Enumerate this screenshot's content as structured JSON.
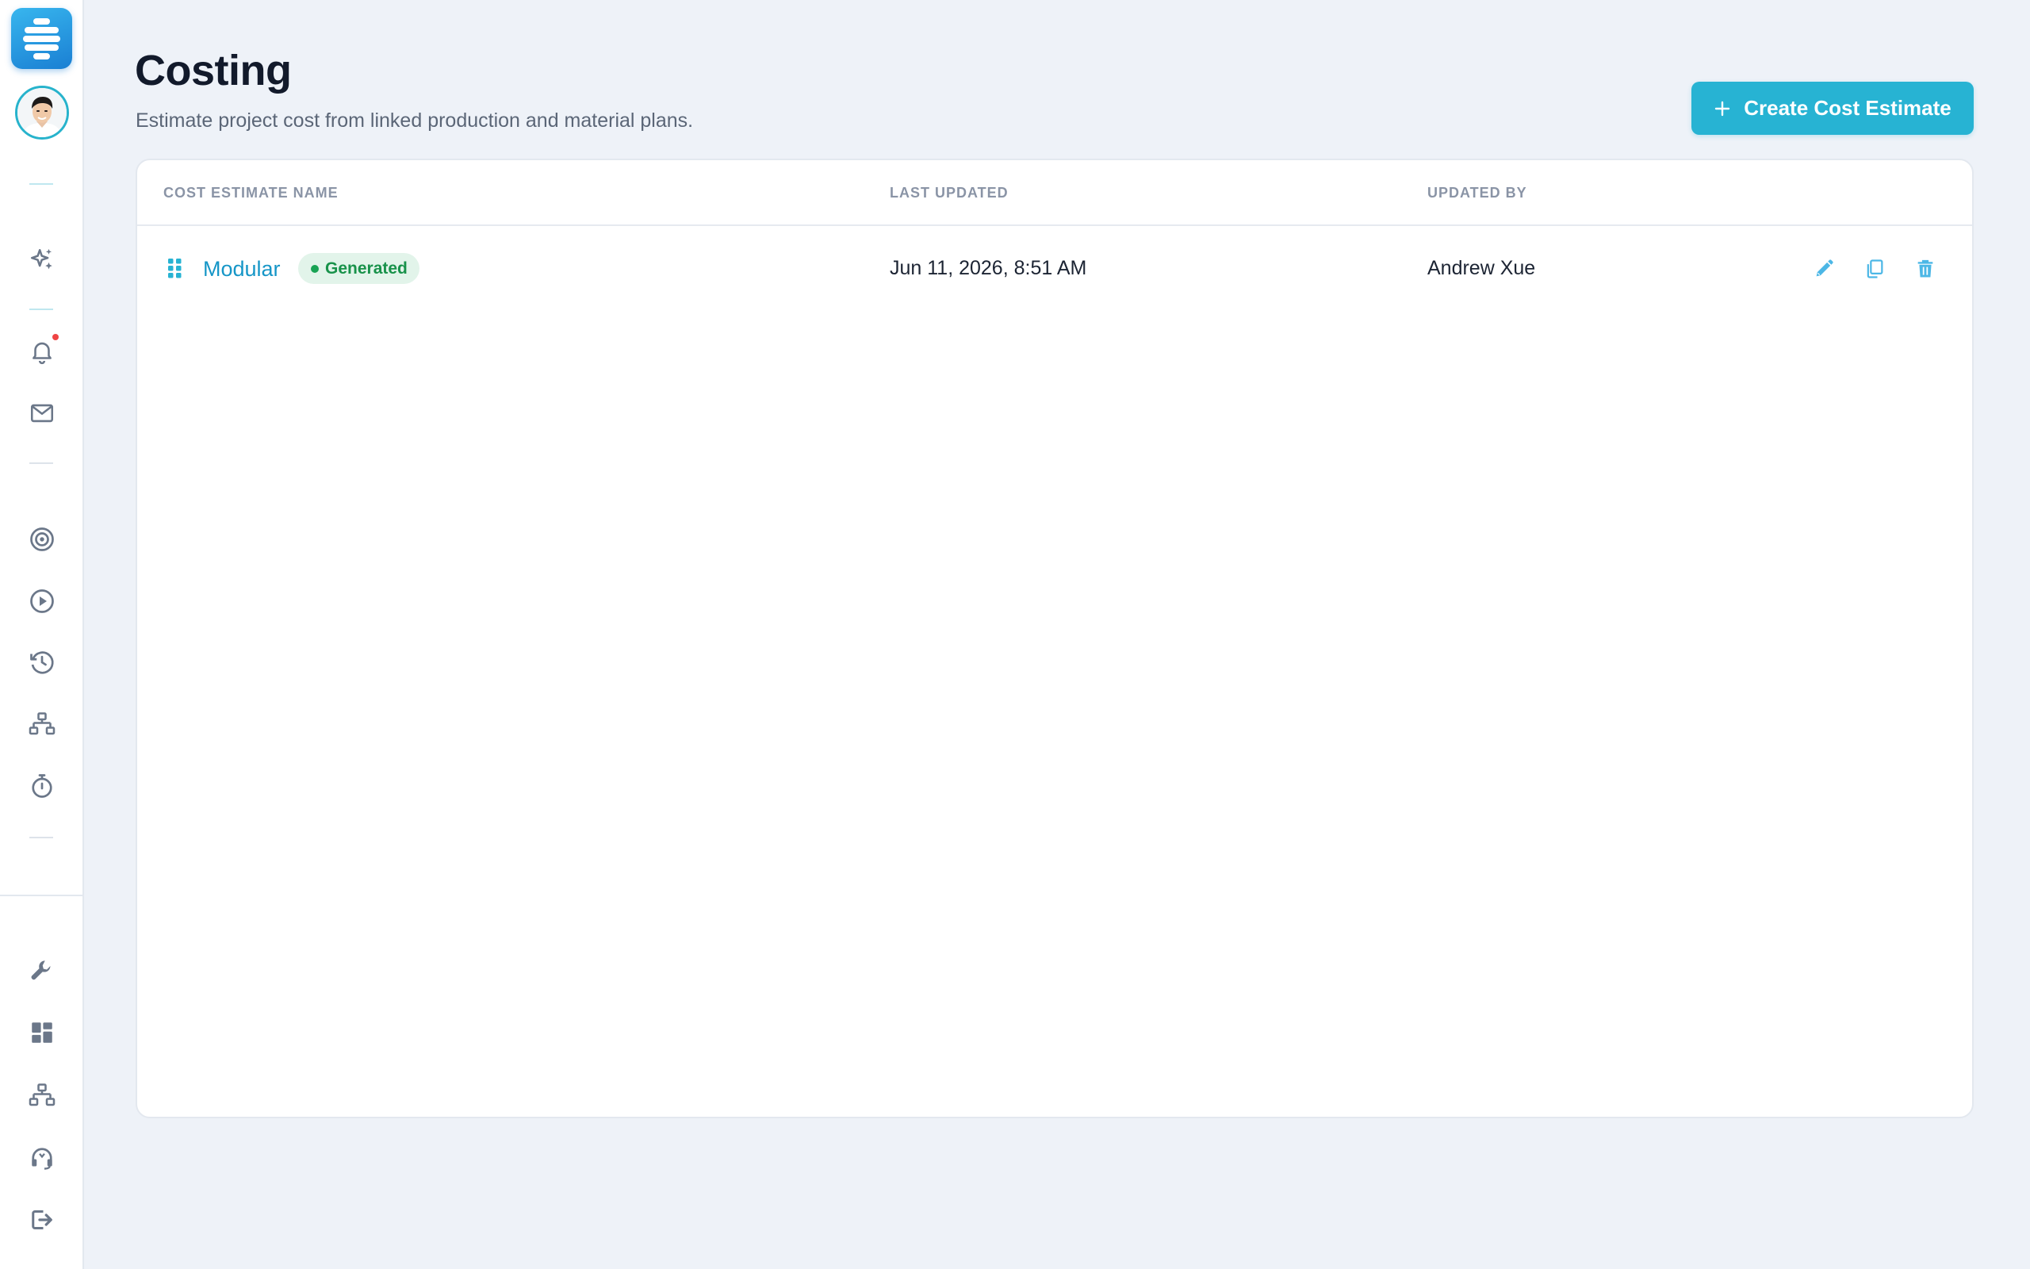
{
  "page": {
    "title": "Costing",
    "subtitle": "Estimate project cost from linked production and material plans."
  },
  "actions": {
    "create_label": "Create Cost Estimate"
  },
  "table": {
    "columns": [
      "COST ESTIMATE NAME",
      "LAST UPDATED",
      "UPDATED BY"
    ],
    "rows": [
      {
        "name": "Modular",
        "status": "Generated",
        "last_updated": "Jun 11, 2026, 8:51 AM",
        "updated_by": "Andrew Xue"
      }
    ]
  },
  "sidebar": {
    "top_icons": [
      "sparkles-icon",
      "bell-icon",
      "mail-icon",
      "target-icon",
      "play-circle-icon",
      "history-icon",
      "hierarchy-icon",
      "stopwatch-icon"
    ],
    "bottom_icons": [
      "wrench-icon",
      "dashboard-grid-icon",
      "org-chart-icon",
      "headset-icon",
      "logout-icon"
    ]
  },
  "colors": {
    "accent": "#27b3d3",
    "link": "#1696c7",
    "status_generated_bg": "#e2f4ea",
    "status_generated_text": "#18924a",
    "notification_dot": "#ef4444",
    "background": "#eef2f8"
  }
}
